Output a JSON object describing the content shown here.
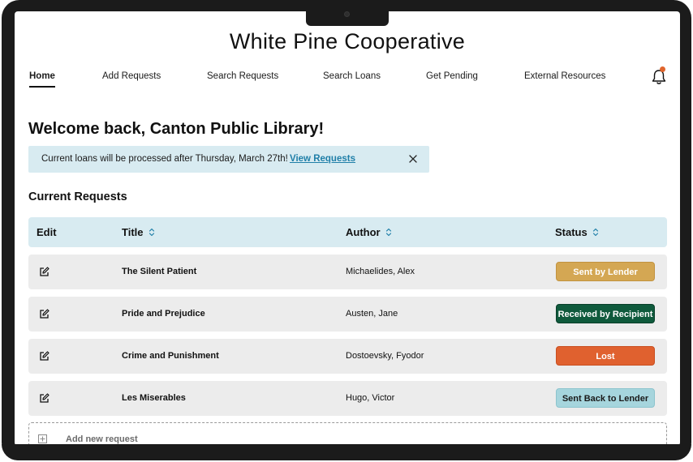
{
  "site": {
    "title": "White Pine Cooperative"
  },
  "nav": {
    "items": [
      {
        "label": "Home",
        "active": true
      },
      {
        "label": "Add Requests"
      },
      {
        "label": "Search Requests"
      },
      {
        "label": "Search Loans"
      },
      {
        "label": "Get Pending"
      },
      {
        "label": "External Resources"
      }
    ],
    "notification_icon": "bell-icon"
  },
  "welcome": {
    "heading": "Welcome back, Canton Public Library!"
  },
  "banner": {
    "text": "Current loans will be processed after Thursday, March 27th!",
    "link_label": "View Requests",
    "close_icon": "close-icon"
  },
  "requests": {
    "section_title": "Current Requests",
    "columns": {
      "edit": "Edit",
      "title": "Title",
      "author": "Author",
      "status": "Status"
    },
    "rows": [
      {
        "title": "The Silent Patient",
        "author": "Michaelides, Alex",
        "status": "Sent by Lender",
        "status_color": "#d4a753",
        "status_text_color": "#ffffff"
      },
      {
        "title": "Pride and Prejudice",
        "author": "Austen, Jane",
        "status": "Received by Recipient",
        "status_color": "#0f5a3c",
        "status_text_color": "#ffffff"
      },
      {
        "title": "Crime and Punishment",
        "author": "Dostoevsky, Fyodor",
        "status": "Lost",
        "status_color": "#e0612f",
        "status_text_color": "#ffffff"
      },
      {
        "title": "Les Miserables",
        "author": "Hugo, Victor",
        "status": "Sent Back to Lender",
        "status_color": "#a6d5dd",
        "status_text_color": "#1a1a1a"
      }
    ],
    "add_label": "Add new request"
  },
  "colors": {
    "accent": "#1f7fa8",
    "header_bg": "#d8ebf1",
    "row_bg": "#ececec",
    "notification_dot": "#e0652d"
  }
}
